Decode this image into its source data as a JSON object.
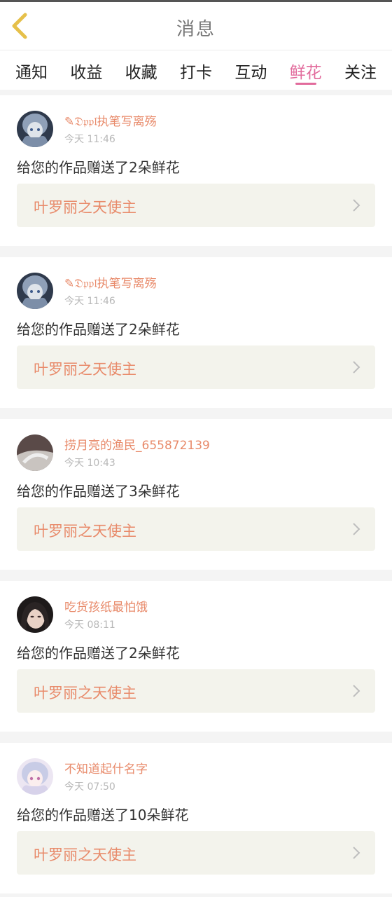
{
  "header": {
    "title": "消息"
  },
  "tabs": [
    {
      "label": "通知"
    },
    {
      "label": "收益"
    },
    {
      "label": "收藏"
    },
    {
      "label": "打卡"
    },
    {
      "label": "互动"
    },
    {
      "label": "鲜花",
      "active": true
    },
    {
      "label": "关注"
    }
  ],
  "colors": {
    "accent": "#e26b9c",
    "name": "#e88a6a",
    "card_bg": "#f3f3ec"
  },
  "messages": [
    {
      "name": "✎𝔇𝔭𝔭𝔩执笔写离殇",
      "time": "今天 11:46",
      "text": "给您的作品赠送了2朵鲜花",
      "work": "叶罗丽之天使主"
    },
    {
      "name": "✎𝔇𝔭𝔭𝔩执笔写离殇",
      "time": "今天 11:46",
      "text": "给您的作品赠送了2朵鲜花",
      "work": "叶罗丽之天使主"
    },
    {
      "name": "捞月亮的渔民_655872139",
      "time": "今天 10:43",
      "text": "给您的作品赠送了3朵鲜花",
      "work": "叶罗丽之天使主"
    },
    {
      "name": "吃货孩纸最怕饿",
      "time": "今天 08:11",
      "text": "给您的作品赠送了2朵鲜花",
      "work": "叶罗丽之天使主"
    },
    {
      "name": "不知道起什名字",
      "time": "今天 07:50",
      "text": "给您的作品赠送了10朵鲜花",
      "work": "叶罗丽之天使主"
    }
  ]
}
